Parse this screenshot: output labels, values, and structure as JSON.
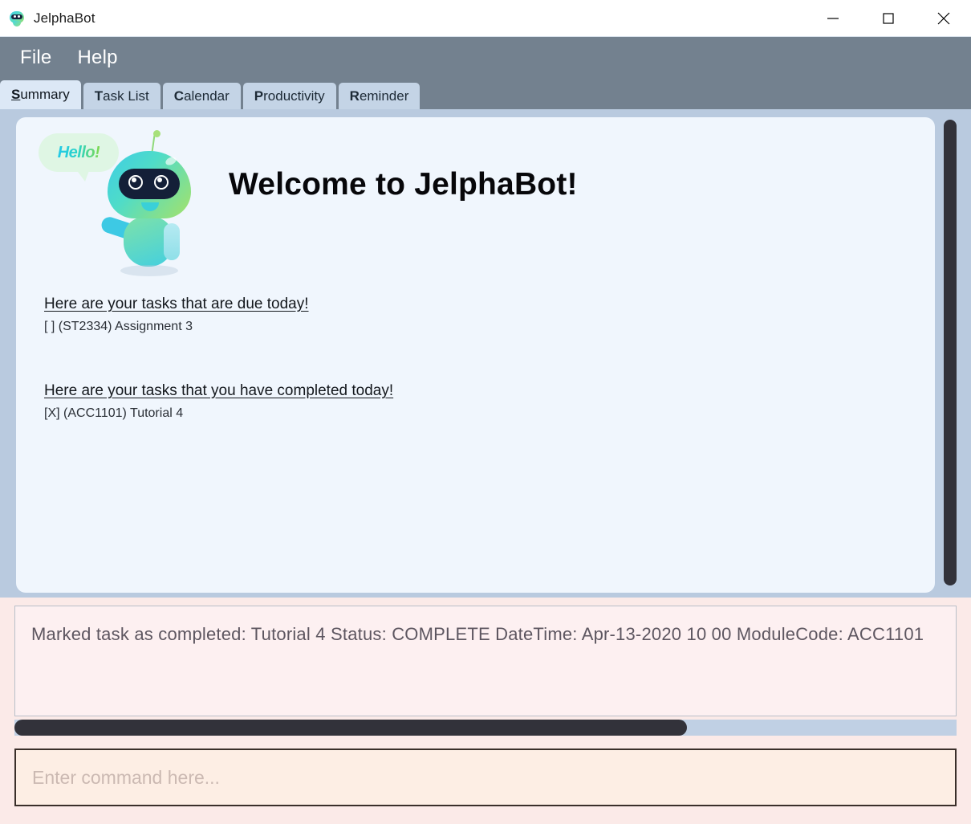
{
  "window": {
    "title": "JelphaBot",
    "app_icon": "robot-icon",
    "controls": {
      "minimize": "minimize-icon",
      "maximize": "maximize-icon",
      "close": "close-icon"
    }
  },
  "menubar": {
    "items": [
      {
        "label": "File"
      },
      {
        "label": "Help"
      }
    ]
  },
  "tabs": [
    {
      "mnemonic": "S",
      "rest": "ummary",
      "label": "Summary",
      "active": true
    },
    {
      "mnemonic": "T",
      "rest": "ask List",
      "label": "Task List",
      "active": false
    },
    {
      "mnemonic": "C",
      "rest": "alendar",
      "label": "Calendar",
      "active": false
    },
    {
      "mnemonic": "P",
      "rest": "roductivity",
      "label": "Productivity",
      "active": false
    },
    {
      "mnemonic": "R",
      "rest": "eminder",
      "label": "Reminder",
      "active": false
    }
  ],
  "summary": {
    "mascot": {
      "bubble_text": "Hello!",
      "alt": "jelphabot-robot-mascot"
    },
    "welcome_heading": "Welcome to JelphaBot!",
    "sections": [
      {
        "heading": "Here are your tasks that are due today!",
        "tasks": [
          {
            "checkbox": "[ ]",
            "text": "[ ] (ST2334) Assignment 3"
          }
        ]
      },
      {
        "heading": "Here are your tasks that you have completed today!",
        "tasks": [
          {
            "checkbox": "[X]",
            "text": "[X] (ACC1101) Tutorial 4"
          }
        ]
      }
    ]
  },
  "feedback": {
    "message": "Marked task as completed: Tutorial 4 Status: COMPLETE DateTime: Apr-13-2020 10 00 ModuleCode: ACC1101"
  },
  "command": {
    "value": "",
    "placeholder": "Enter command here..."
  },
  "colors": {
    "menubar": "#73818f",
    "window_bg": "#b9cadf",
    "tab_active": "#dce8f6",
    "tab_inactive": "#c4d4e6",
    "content_panel": "#f0f6fd",
    "feedback_bg": "#fbeae8",
    "feedback_box": "#fdf0f1",
    "command_bg": "#fdeee4",
    "scrollbar_thumb": "#32323a"
  }
}
